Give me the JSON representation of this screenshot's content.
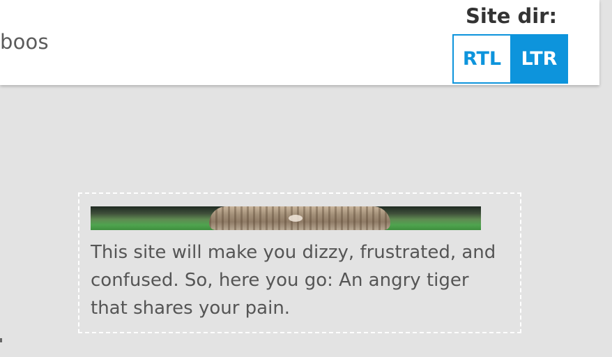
{
  "header": {
    "partial_text": "boos"
  },
  "site_dir": {
    "label": "Site dir:",
    "options": [
      "RTL",
      "LTR"
    ],
    "selected": "LTR"
  },
  "card": {
    "image_alt": "An angry tiger",
    "caption": "This site will make you dizzy, frustrated, and confused. So, here you go: An angry tiger that shares your pain."
  },
  "colors": {
    "accent": "#0d94dc",
    "background": "#e3e3e3",
    "header_bg": "#ffffff"
  }
}
